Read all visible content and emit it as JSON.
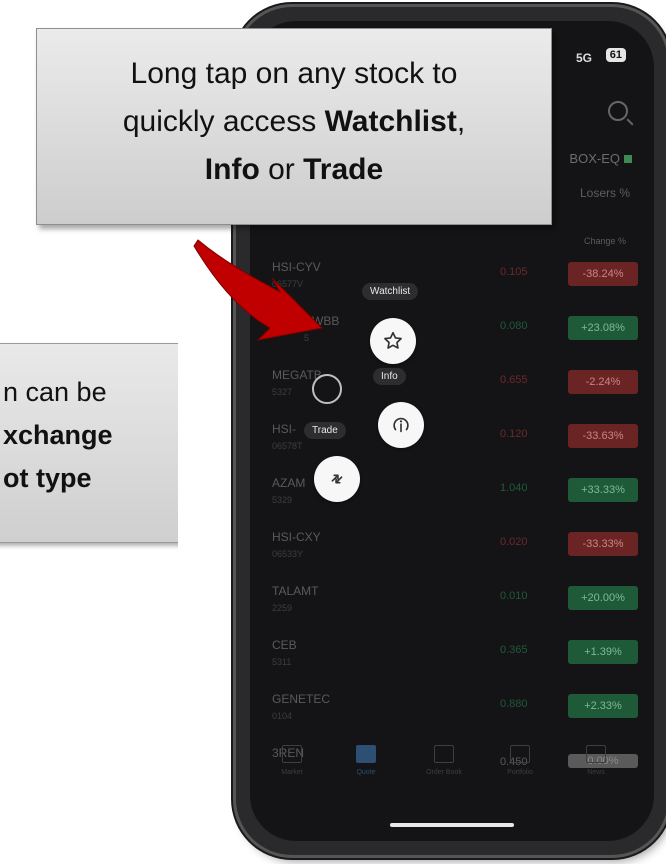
{
  "callout_top": {
    "line1": "Long tap on any stock to",
    "line2_pre": "quickly access ",
    "line2_bold": "Watchlist",
    "line2_post": ",",
    "line3_b1": "Info",
    "line3_mid": " or ",
    "line3_b2": "Trade"
  },
  "callout_left": {
    "line1": "n can be",
    "line2": "xchange",
    "line3": "ot type"
  },
  "status": {
    "network": "5G",
    "battery": "61"
  },
  "header": {
    "exchange": "BOX-EQ",
    "sort_tab": "Losers %",
    "col_change": "Change %"
  },
  "rows": [
    {
      "symbol": "HSI-CYV",
      "code": "06577V",
      "price": "0.105",
      "change": "-38.24%",
      "dir": "down"
    },
    {
      "symbol": "PWBB",
      "code": "5",
      "price": "0.080",
      "change": "+23.08%",
      "dir": "up"
    },
    {
      "symbol": "MEGATB",
      "code": "5327",
      "price": "0.655",
      "change": "-2.24%",
      "dir": "down"
    },
    {
      "symbol": "HSI-",
      "code": "06578T",
      "price": "0.120",
      "change": "-33.63%",
      "dir": "down"
    },
    {
      "symbol": "AZAM",
      "code": "5329",
      "price": "1.040",
      "change": "+33.33%",
      "dir": "up"
    },
    {
      "symbol": "HSI-CXY",
      "code": "06533Y",
      "price": "0.020",
      "change": "-33.33%",
      "dir": "down"
    },
    {
      "symbol": "TALAMT",
      "code": "2259",
      "price": "0.010",
      "change": "+20.00%",
      "dir": "up"
    },
    {
      "symbol": "CEB",
      "code": "5311",
      "price": "0.365",
      "change": "+1.39%",
      "dir": "up"
    },
    {
      "symbol": "GENETEC",
      "code": "0104",
      "price": "0.880",
      "change": "+2.33%",
      "dir": "up"
    },
    {
      "symbol": "3REN",
      "code": "",
      "price": "0.450",
      "change": "0.00%",
      "dir": "flat"
    }
  ],
  "context_menu": {
    "watchlist": "Watchlist",
    "info": "Info",
    "trade": "Trade"
  },
  "nav": [
    "Market",
    "Quote",
    "Order Book",
    "Portfolio",
    "News"
  ],
  "colors": {
    "up": "#1f5a38",
    "down": "#6a2424",
    "flat": "#5a5a5a",
    "arrow": "#c00000"
  }
}
